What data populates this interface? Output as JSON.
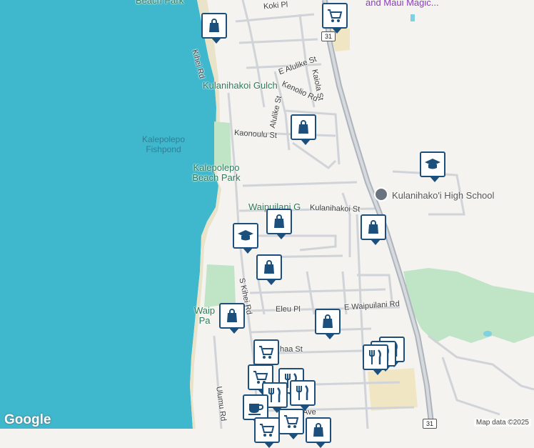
{
  "labels": {
    "beach_park_top": "Beach Park",
    "maui_magic": "and Maui Magic...",
    "koki_pl": "Koki Pl",
    "kihei_rd_top": "Kihei Rd",
    "e_alulike_st": "E Alulike St",
    "kenolio_rd": "Kenolio Rd",
    "kaiola_st": "Kaiola St",
    "alulike_st": "Alulike St",
    "kulanihakoi_gulch": "Kulanihakoi Gulch",
    "kaonoulu_st": "Kaonoulu St",
    "kalepolepo_fishpond": "Kalepolepo Fishpond",
    "kalepolepo_beach_park": "Kalepolepo Beach Park",
    "kulanihakoi_high_school": "Kulanihako'i High School",
    "waipuilani_g": "Waipuilani G",
    "kulanihakoi_st": "Kulanihakoi St",
    "s_kihei_rd": "S Kihei Rd",
    "eleu_pl": "Eleu Pl",
    "e_waipuilani_rd": "E Waipuilani Rd",
    "waip_pa": "Waip\nPa",
    "haa_st": "haa St",
    "ulumu_rd": "Ulumu Rd",
    "ave": "Ave",
    "route_31": "31"
  },
  "attribution": {
    "logo": "Google",
    "map_data": "Map data ©2025"
  },
  "colors": {
    "water": "#3fb8ce",
    "land": "#f4f3ef",
    "park": "#bfe4c6",
    "road": "#d0d3d8",
    "highway": "#aeb4bc",
    "pin_border": "#1d4f7d"
  },
  "markers": [
    {
      "icon": "shopping-bag-icon"
    },
    {
      "icon": "shopping-cart-icon"
    },
    {
      "icon": "shopping-bag-icon"
    },
    {
      "icon": "school-icon"
    },
    {
      "icon": "shopping-bag-icon"
    },
    {
      "icon": "shopping-bag-icon"
    },
    {
      "icon": "school-icon"
    },
    {
      "icon": "shopping-bag-icon"
    },
    {
      "icon": "shopping-bag-icon"
    },
    {
      "icon": "shopping-bag-icon"
    },
    {
      "icon": "shopping-cart-icon"
    },
    {
      "icon": "restaurant-icon"
    },
    {
      "icon": "cafe-icon"
    }
  ]
}
